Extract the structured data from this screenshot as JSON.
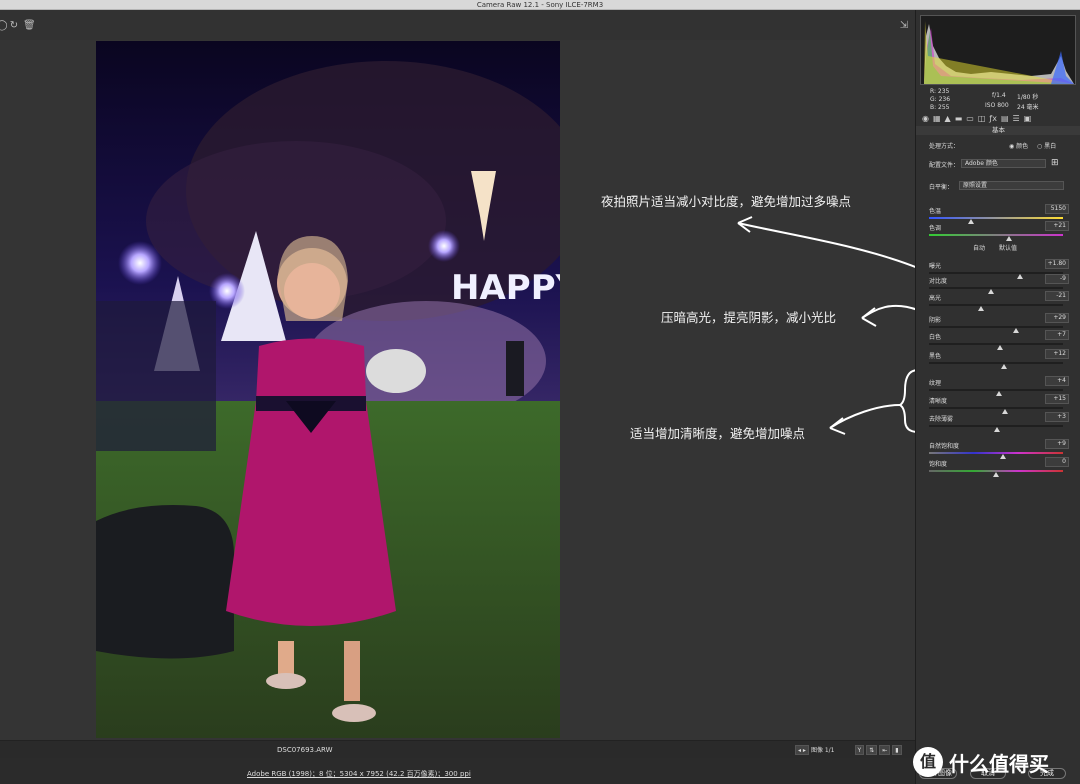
{
  "window": {
    "title": "Camera Raw 12.1 -  Sony ILCE-7RM3"
  },
  "toolbar": {
    "icons": [
      "circle-icon",
      "rotate-icon",
      "trash-icon",
      "save-icon"
    ]
  },
  "annotations": {
    "a1": "夜拍照片适当减小对比度，避免增加过多噪点",
    "a2": "压暗高光，提亮阴影，减小光比",
    "a3": "适当增加清晰度，避免增加噪点"
  },
  "filmstrip": {
    "filename": "DSC07693.ARW",
    "image_index": "图像 1/1",
    "y_label": "Y"
  },
  "status": {
    "workflow": "Adobe RGB (1998)；8 位；5304 x 7952 (42.2 百万像素)；300 ppi"
  },
  "readout": {
    "r": "R:   235",
    "g": "G:   236",
    "b": "B:   255",
    "aperture": "f/1.4",
    "shutter": "1/80 秒",
    "iso": "ISO 800",
    "focal": "24 毫米"
  },
  "panel": {
    "section": "基本",
    "treatment_label": "处理方式：",
    "color_label": "颜色",
    "bw_label": "黑白",
    "profile_label": "配置文件：",
    "profile_value": "Adobe 颜色",
    "wb_label": "白平衡：",
    "wb_value": "原照设置",
    "auto_label": "自动",
    "default_label": "默认值",
    "sliders": [
      {
        "label": "色温",
        "value": "5150",
        "pos": 0.31
      },
      {
        "label": "色调",
        "value": "+21",
        "pos": 0.6
      },
      {
        "label": "曝光",
        "value": "+1.80",
        "pos": 0.68
      },
      {
        "label": "对比度",
        "value": "-9",
        "pos": 0.46
      },
      {
        "label": "高光",
        "value": "-21",
        "pos": 0.39
      },
      {
        "label": "阴影",
        "value": "+29",
        "pos": 0.65
      },
      {
        "label": "白色",
        "value": "+7",
        "pos": 0.53
      },
      {
        "label": "黑色",
        "value": "+12",
        "pos": 0.56
      },
      {
        "label": "纹理",
        "value": "+4",
        "pos": 0.52
      },
      {
        "label": "清晰度",
        "value": "+15",
        "pos": 0.57
      },
      {
        "label": "去除薄雾",
        "value": "+3",
        "pos": 0.51
      },
      {
        "label": "自然饱和度",
        "value": "+9",
        "pos": 0.55
      },
      {
        "label": "饱和度",
        "value": "0",
        "pos": 0.5
      }
    ]
  },
  "buttons": {
    "open": "打开图像",
    "cancel": "取消",
    "done": "完成"
  },
  "watermark": {
    "logo": "值",
    "text": "什么值得买"
  }
}
